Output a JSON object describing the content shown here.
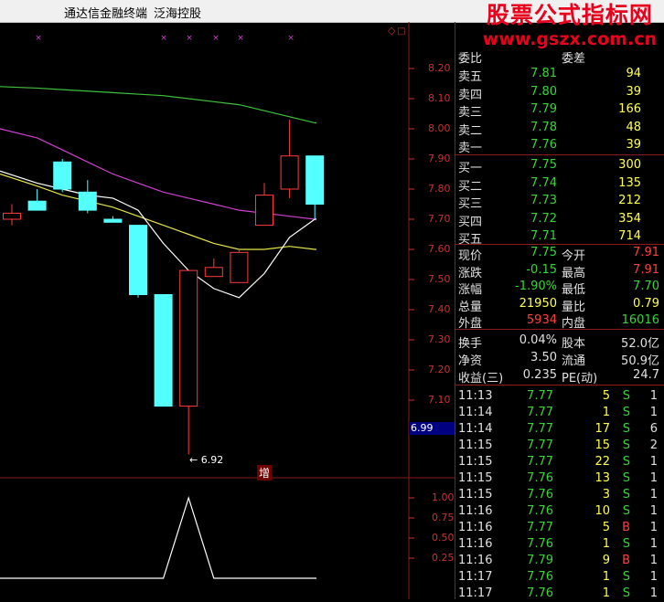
{
  "window": {
    "app_title": "通达信金融终端",
    "stock_name": "泛海控股"
  },
  "watermark": {
    "line1": "股票公式指标网",
    "line2": "www.gszx.com.cn"
  },
  "main_chart": {
    "y_ticks": [
      "8.20",
      "8.10",
      "8.00",
      "7.90",
      "7.80",
      "7.70",
      "7.60",
      "7.50",
      "7.40",
      "7.30",
      "7.20",
      "7.10"
    ],
    "current_price_label": "6.99",
    "min_label": "6.92",
    "marker_label": "增"
  },
  "sub_chart": {
    "y_ticks": [
      "1.00",
      "0.75",
      "0.50",
      "0.25"
    ]
  },
  "chart_data": {
    "type": "candlestick",
    "ylim": [
      6.9,
      8.25
    ],
    "candles": [
      {
        "o": 7.7,
        "c": 7.72,
        "h": 7.75,
        "l": 7.68
      },
      {
        "o": 7.76,
        "c": 7.73,
        "h": 7.8,
        "l": 7.73
      },
      {
        "o": 7.89,
        "c": 7.8,
        "h": 7.9,
        "l": 7.79
      },
      {
        "o": 7.79,
        "c": 7.73,
        "h": 7.83,
        "l": 7.72
      },
      {
        "o": 7.7,
        "c": 7.69,
        "h": 7.71,
        "l": 7.69
      },
      {
        "o": 7.68,
        "c": 7.45,
        "h": 7.68,
        "l": 7.44
      },
      {
        "o": 7.45,
        "c": 7.08,
        "h": 7.45,
        "l": 7.08
      },
      {
        "o": 7.08,
        "c": 7.53,
        "h": 7.53,
        "l": 6.92
      },
      {
        "o": 7.51,
        "c": 7.54,
        "h": 7.57,
        "l": 7.51
      },
      {
        "o": 7.49,
        "c": 7.59,
        "h": 7.6,
        "l": 7.49
      },
      {
        "o": 7.68,
        "c": 7.78,
        "h": 7.82,
        "l": 7.68
      },
      {
        "o": 7.8,
        "c": 7.91,
        "h": 8.03,
        "l": 7.77
      },
      {
        "o": 7.91,
        "c": 7.75,
        "h": 7.91,
        "l": 7.7
      }
    ],
    "ma_lines": [
      {
        "color": "#3ec23e",
        "values": [
          8.14,
          8.135,
          8.13,
          8.125,
          8.12,
          8.115,
          8.11,
          8.1,
          8.09,
          8.08,
          8.06,
          8.04,
          8.02
        ]
      },
      {
        "color": "#d040d0",
        "values": [
          8.0,
          7.97,
          7.93,
          7.89,
          7.85,
          7.82,
          7.79,
          7.77,
          7.75,
          7.73,
          7.72,
          7.71,
          7.7
        ]
      },
      {
        "color": "#e6e64a",
        "values": [
          7.85,
          7.81,
          7.78,
          7.76,
          7.74,
          7.71,
          7.68,
          7.65,
          7.62,
          7.6,
          7.6,
          7.61,
          7.6
        ]
      },
      {
        "color": "#ffffff",
        "values": [
          7.86,
          7.82,
          7.8,
          7.78,
          7.77,
          7.73,
          7.62,
          7.53,
          7.47,
          7.44,
          7.52,
          7.64,
          7.7
        ]
      }
    ],
    "indicator": [
      0,
      0,
      0,
      0,
      0,
      0,
      0,
      1,
      0,
      0,
      0,
      0,
      0
    ]
  },
  "order_book": {
    "header_left": "委比",
    "header_right": "委差",
    "asks": [
      {
        "label": "卖五",
        "price": "7.81",
        "vol": "94"
      },
      {
        "label": "卖四",
        "price": "7.80",
        "vol": "39"
      },
      {
        "label": "卖三",
        "price": "7.79",
        "vol": "166"
      },
      {
        "label": "卖二",
        "price": "7.78",
        "vol": "48"
      },
      {
        "label": "卖一",
        "price": "7.76",
        "vol": "39"
      }
    ],
    "bids": [
      {
        "label": "买一",
        "price": "7.75",
        "vol": "300"
      },
      {
        "label": "买二",
        "price": "7.74",
        "vol": "135"
      },
      {
        "label": "买三",
        "price": "7.73",
        "vol": "212"
      },
      {
        "label": "买四",
        "price": "7.72",
        "vol": "354"
      },
      {
        "label": "买五",
        "price": "7.71",
        "vol": "714"
      }
    ]
  },
  "quote": [
    {
      "l1": "现价",
      "v1": "7.75",
      "c1": "grn",
      "l2": "今开",
      "v2": "7.91",
      "c2": "red"
    },
    {
      "l1": "涨跌",
      "v1": "-0.15",
      "c1": "grn",
      "l2": "最高",
      "v2": "7.91",
      "c2": "red"
    },
    {
      "l1": "涨幅",
      "v1": "-1.90%",
      "c1": "grn",
      "l2": "最低",
      "v2": "7.70",
      "c2": "grn"
    },
    {
      "l1": "总量",
      "v1": "21950",
      "c1": "yel",
      "l2": "量比",
      "v2": "0.79",
      "c2": "yel"
    },
    {
      "l1": "外盘",
      "v1": "5934",
      "c1": "red",
      "l2": "内盘",
      "v2": "16016",
      "c2": "grn"
    }
  ],
  "fundamentals": [
    {
      "l1": "换手",
      "v1": "0.04%",
      "l2": "股本",
      "v2": "52.0亿"
    },
    {
      "l1": "净资",
      "v1": "3.50",
      "l2": "流通",
      "v2": "50.9亿"
    },
    {
      "l1": "收益(三)",
      "v1": "0.235",
      "l2": "PE(动)",
      "v2": "24.7"
    }
  ],
  "ticks": [
    {
      "t": "11:13",
      "p": "7.77",
      "v": "5",
      "bs": "S",
      "n": "1"
    },
    {
      "t": "11:14",
      "p": "7.77",
      "v": "1",
      "bs": "S",
      "n": "1"
    },
    {
      "t": "11:14",
      "p": "7.77",
      "v": "17",
      "bs": "S",
      "n": "6"
    },
    {
      "t": "11:15",
      "p": "7.77",
      "v": "15",
      "bs": "S",
      "n": "2"
    },
    {
      "t": "11:15",
      "p": "7.77",
      "v": "22",
      "bs": "S",
      "n": "1"
    },
    {
      "t": "11:15",
      "p": "7.76",
      "v": "13",
      "bs": "S",
      "n": "1"
    },
    {
      "t": "11:15",
      "p": "7.76",
      "v": "3",
      "bs": "S",
      "n": "1"
    },
    {
      "t": "11:16",
      "p": "7.76",
      "v": "10",
      "bs": "S",
      "n": "1"
    },
    {
      "t": "11:16",
      "p": "7.77",
      "v": "5",
      "bs": "B",
      "n": "1"
    },
    {
      "t": "11:16",
      "p": "7.76",
      "v": "1",
      "bs": "S",
      "n": "1"
    },
    {
      "t": "11:16",
      "p": "7.79",
      "v": "9",
      "bs": "B",
      "n": "1"
    },
    {
      "t": "11:17",
      "p": "7.76",
      "v": "1",
      "bs": "S",
      "n": "1"
    },
    {
      "t": "11:17",
      "p": "7.76",
      "v": "1",
      "bs": "S",
      "n": "1"
    }
  ]
}
